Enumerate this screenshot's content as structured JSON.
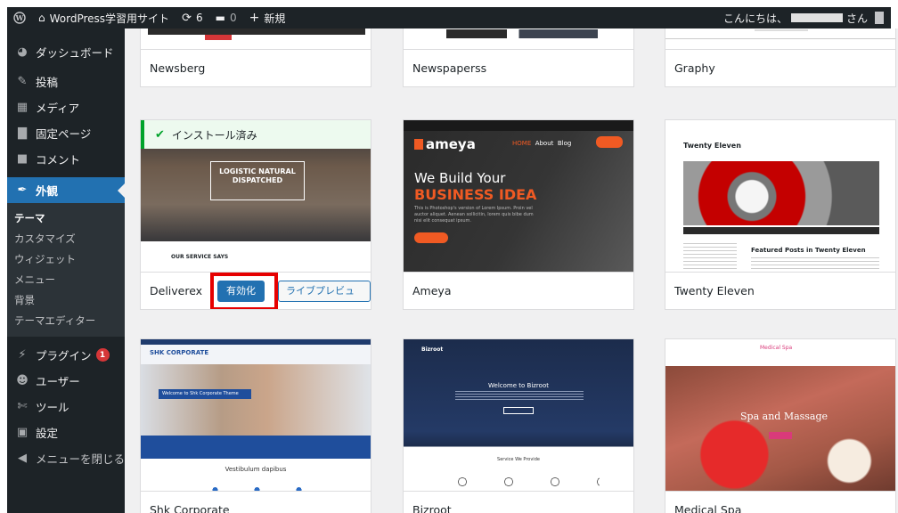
{
  "adminbar": {
    "site_name": "WordPress学習用サイト",
    "updates_count": "6",
    "comments_count": "0",
    "new_label": "新規",
    "greeting": "こんにちは、",
    "greeting_suffix": "さん"
  },
  "sidebar": {
    "items": [
      {
        "label": "ダッシュボード",
        "icon": "dashboard-icon"
      },
      {
        "label": "投稿",
        "icon": "pin-icon"
      },
      {
        "label": "メディア",
        "icon": "media-icon"
      },
      {
        "label": "固定ページ",
        "icon": "page-icon"
      },
      {
        "label": "コメント",
        "icon": "comment-icon"
      },
      {
        "label": "外観",
        "icon": "appearance-icon"
      }
    ],
    "submenu": [
      "テーマ",
      "カスタマイズ",
      "ウィジェット",
      "メニュー",
      "背景",
      "テーマエディター"
    ],
    "items2": [
      {
        "label": "プラグイン",
        "icon": "plugin-icon",
        "badge": "1"
      },
      {
        "label": "ユーザー",
        "icon": "user-icon"
      },
      {
        "label": "ツール",
        "icon": "tools-icon"
      },
      {
        "label": "設定",
        "icon": "settings-icon"
      },
      {
        "label": "メニューを閉じる",
        "icon": "collapse-icon"
      }
    ]
  },
  "themes": {
    "row1": [
      "Newsberg",
      "Newspaperss",
      "Graphy"
    ],
    "deliverex": {
      "name": "Deliverex",
      "installed_notice": "インストール済み",
      "activate_label": "有効化",
      "preview_label": "ライブプレビュー",
      "thumb_box_text": "LOGISTIC NATURAL DISPATCHED",
      "thumb_service_text": "OUR SERVICE SAYS"
    },
    "ameya": {
      "name": "Ameya",
      "logo": "ameya",
      "nav_home": "HOME",
      "nav_about": "About",
      "nav_blog": "Blog",
      "headline1": "We Build Your",
      "headline2": "BUSINESS IDEA",
      "para": "This is Photoshop's version of Lorem Ipsum. Proin vel auctor aliquet. Aenean sollicitin, lorem quis bibe dum nisi elit consequat ipsum."
    },
    "twentyeleven": {
      "name": "Twenty Eleven",
      "thumb_title": "Twenty Eleven",
      "thumb_featured": "Featured Posts in Twenty Eleven"
    },
    "row3": {
      "shk": "Shk Corporate",
      "shk_logo": "SHK CORPORATE",
      "shk_welcome": "Welcome to Shk Corporate Theme",
      "shk_vest": "Vestibulum dapibus",
      "bizroot": "Bizroot",
      "bizroot_logo": "Bizroot",
      "bizroot_welcome": "Welcome to Bizroot",
      "bizroot_service": "Service We Provide",
      "spa": "Medical Spa",
      "spa_logo": "Medical Spa",
      "spa_hero": "Spa and Massage"
    }
  }
}
